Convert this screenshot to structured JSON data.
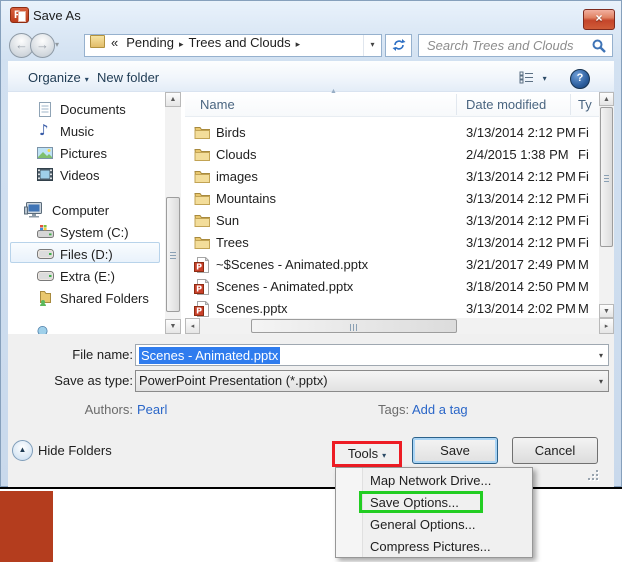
{
  "window": {
    "title": "Save As",
    "app_icon": "powerpoint"
  },
  "glyphs": {
    "close": "×",
    "dropdown": "▾",
    "back": "←",
    "forward": "→",
    "crumb_chevron": "▸",
    "guillemet": "«",
    "sort_asc": "▲",
    "up": "▲",
    "down": "▼",
    "left": "◂",
    "right": "▸",
    "note": "♪",
    "help": "?",
    "hide": "▲"
  },
  "address_bar": {
    "crumb_prefix": "«",
    "crumbs": [
      {
        "label": "Pending"
      },
      {
        "label": "Trees and Clouds"
      }
    ],
    "search_placeholder": "Search Trees and Clouds"
  },
  "toolbar": {
    "organize_label": "Organize",
    "new_folder_label": "New folder"
  },
  "sidebar": {
    "items": [
      {
        "label": "Documents"
      },
      {
        "label": "Music"
      },
      {
        "label": "Pictures"
      },
      {
        "label": "Videos"
      },
      {
        "label": "Computer"
      },
      {
        "label": "System (C:)"
      },
      {
        "label": "Files (D:)",
        "selected": true
      },
      {
        "label": "Extra (E:)"
      },
      {
        "label": "Shared Folders"
      }
    ]
  },
  "file_list": {
    "columns": {
      "name": "Name",
      "date": "Date modified",
      "type": "Ty"
    },
    "rows": [
      {
        "name": "Birds",
        "date": "3/13/2014 2:12 PM",
        "type": "Fi",
        "icon": "folder"
      },
      {
        "name": "Clouds",
        "date": "2/4/2015 1:38 PM",
        "type": "Fi",
        "icon": "folder"
      },
      {
        "name": "images",
        "date": "3/13/2014 2:12 PM",
        "type": "Fi",
        "icon": "folder"
      },
      {
        "name": "Mountains",
        "date": "3/13/2014 2:12 PM",
        "type": "Fi",
        "icon": "folder"
      },
      {
        "name": "Sun",
        "date": "3/13/2014 2:12 PM",
        "type": "Fi",
        "icon": "folder"
      },
      {
        "name": "Trees",
        "date": "3/13/2014 2:12 PM",
        "type": "Fi",
        "icon": "folder"
      },
      {
        "name": "~$Scenes - Animated.pptx",
        "date": "3/21/2017 2:49 PM",
        "type": "M",
        "icon": "pptx"
      },
      {
        "name": "Scenes - Animated.pptx",
        "date": "3/18/2014 2:50 PM",
        "type": "M",
        "icon": "pptx"
      },
      {
        "name": "Scenes.pptx",
        "date": "3/13/2014 2:02 PM",
        "type": "M",
        "icon": "pptx"
      }
    ]
  },
  "fields": {
    "file_name_label": "File name:",
    "file_name_value": "Scenes - Animated.pptx",
    "save_type_label": "Save as type:",
    "save_type_value": "PowerPoint Presentation (*.pptx)",
    "authors_label": "Authors:",
    "authors_value": "Pearl",
    "tags_label": "Tags:",
    "tags_value": "Add a tag"
  },
  "footer": {
    "hide_folders_label": "Hide Folders",
    "tools_label": "Tools",
    "save_label": "Save",
    "cancel_label": "Cancel"
  },
  "tools_menu": {
    "items": [
      {
        "label": "Map Network Drive..."
      },
      {
        "label": "Save Options...",
        "highlighted": true
      },
      {
        "label": "General Options..."
      },
      {
        "label": "Compress Pictures..."
      }
    ]
  },
  "colors": {
    "annotation_red": "#ed1c24",
    "annotation_green": "#22cd22",
    "selection_blue": "#2f7cee",
    "link_blue": "#2a66c8",
    "brand_red_square": "#b43d1e"
  }
}
